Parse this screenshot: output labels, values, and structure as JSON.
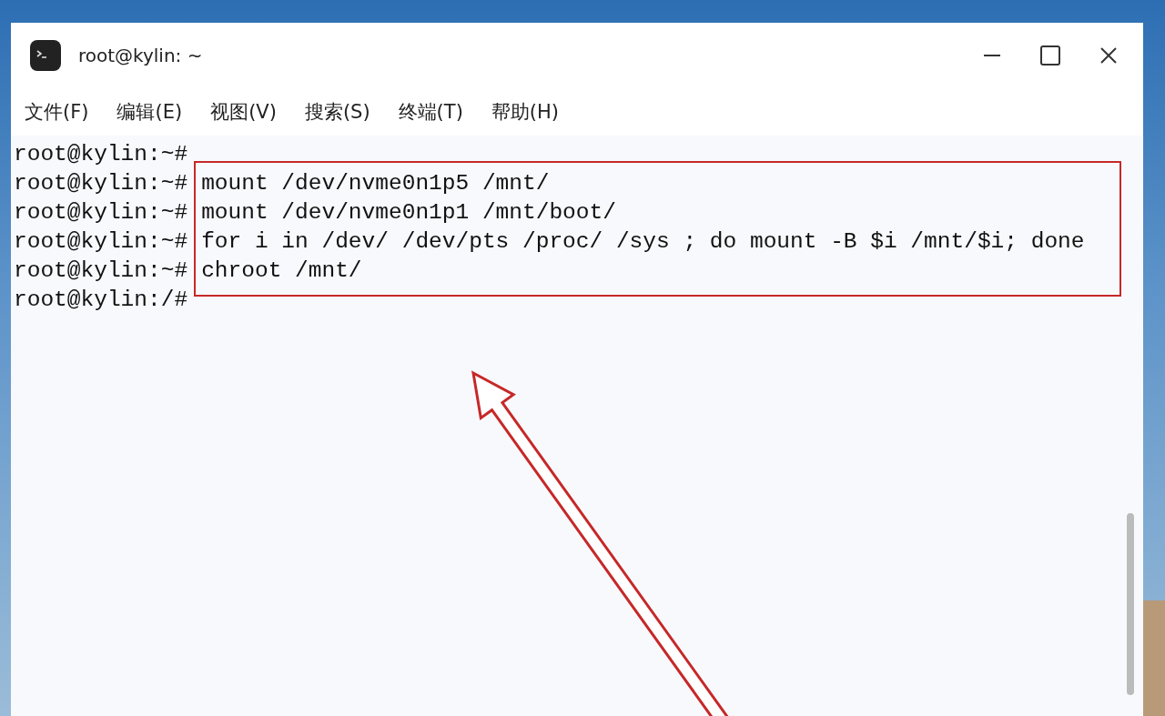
{
  "window": {
    "title": "root@kylin: ~"
  },
  "menu": [
    "文件(F)",
    "编辑(E)",
    "视图(V)",
    "搜索(S)",
    "终端(T)",
    "帮助(H)"
  ],
  "terminal_lines": [
    {
      "prompt": "root@kylin:~#"
    },
    {
      "prompt": "root@kylin:~#",
      "command": "mount /dev/nvme0n1p5 /mnt/"
    },
    {
      "prompt": "root@kylin:~#",
      "command": "mount /dev/nvme0n1p1 /mnt/boot/"
    },
    {
      "prompt": "root@kylin:~#",
      "command": "for i in /dev/ /dev/pts /proc/ /sys ; do mount -B $i /mnt/$i; done"
    },
    {
      "prompt": "root@kylin:~#",
      "command": "chroot /mnt/"
    },
    {
      "prompt": "root@kylin:/#"
    }
  ]
}
